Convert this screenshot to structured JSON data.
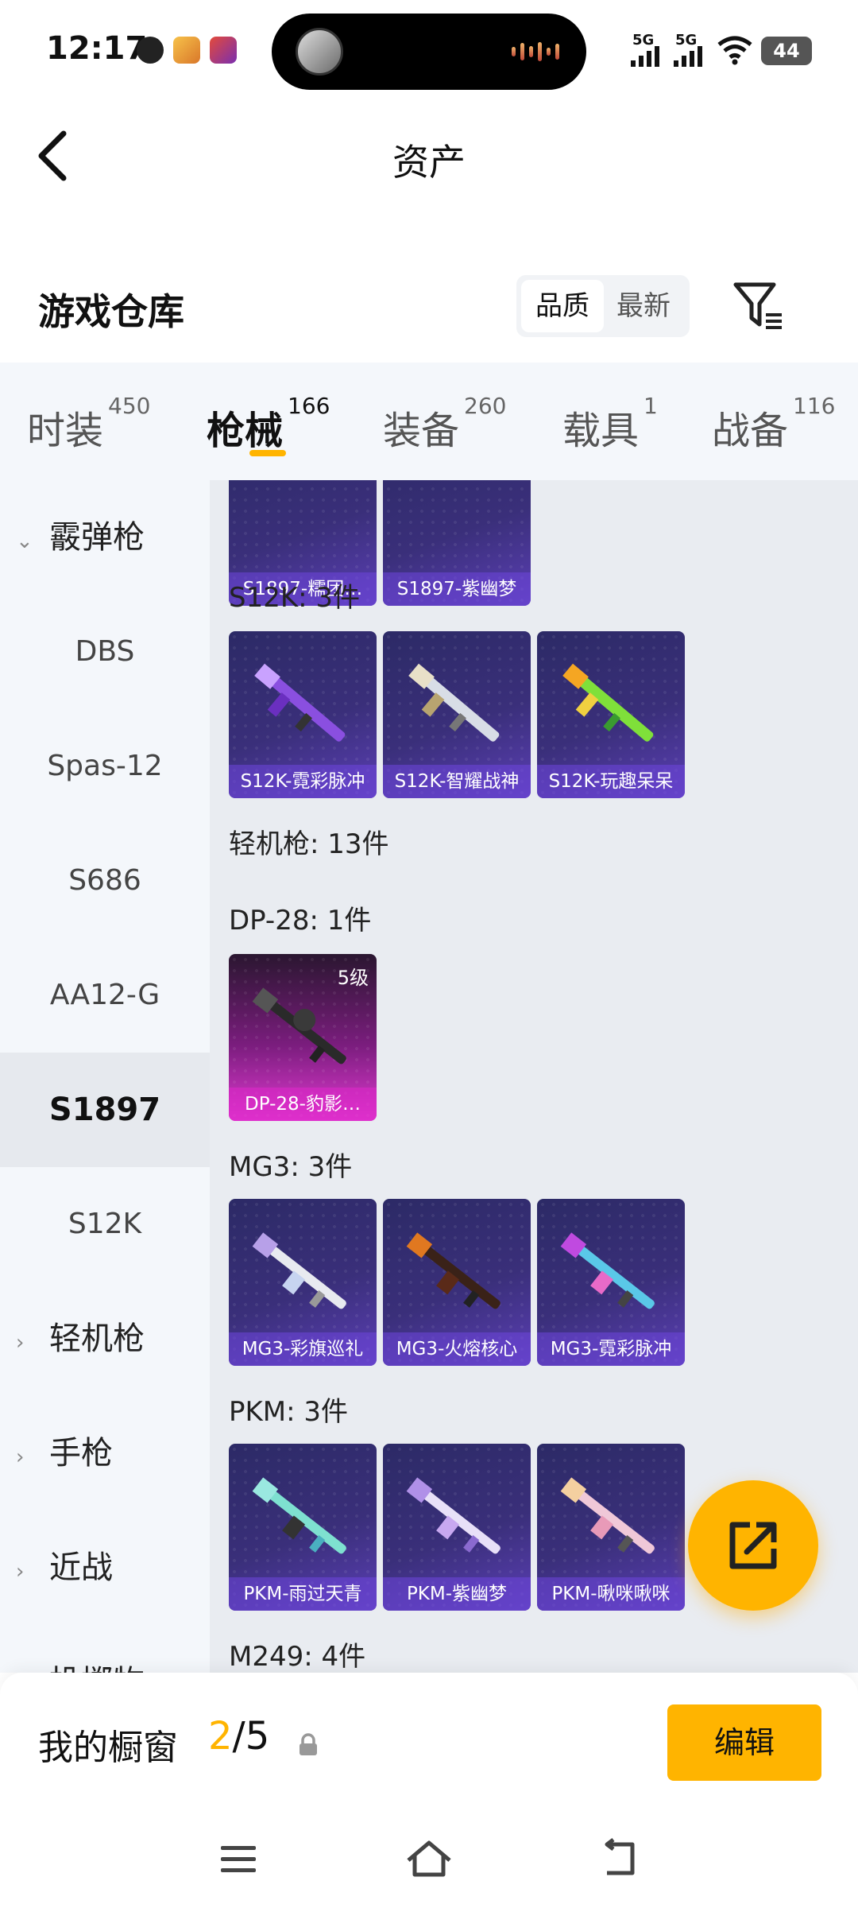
{
  "status_bar": {
    "time": "12:17",
    "signal_1": "5G",
    "signal_2": "5G",
    "battery": "44"
  },
  "header": {
    "title": "资产"
  },
  "warehouse": {
    "title": "游戏仓库",
    "sort_options": [
      "品质",
      "最新"
    ]
  },
  "tabs": [
    {
      "label": "时装",
      "count": "450"
    },
    {
      "label": "枪械",
      "count": "166"
    },
    {
      "label": "装备",
      "count": "260"
    },
    {
      "label": "载具",
      "count": "1"
    },
    {
      "label": "战备",
      "count": "116"
    }
  ],
  "sidebar": {
    "group_shotgun": "霰弹枪",
    "items": [
      "DBS",
      "Spas-12",
      "S686",
      "AA12-G",
      "S1897",
      "S12K"
    ],
    "group_lmg": "轻机枪",
    "group_pistol": "手枪",
    "group_melee": "近战",
    "group_next": "投掷物"
  },
  "content": {
    "s1897_cards": [
      "S1897-糯团…",
      "S1897-紫幽梦"
    ],
    "s12k_label": "S12K: 3件",
    "s12k_cards": [
      "S12K-霓彩脉冲",
      "S12K-智耀战神",
      "S12K-玩趣呆呆"
    ],
    "lmg_label": "轻机枪: 13件",
    "dp28_label": "DP-28: 1件",
    "dp28_card": {
      "name": "DP-28-豹影…",
      "level": "5级"
    },
    "mg3_label": "MG3: 3件",
    "mg3_cards": [
      "MG3-彩旗巡礼",
      "MG3-火熔核心",
      "MG3-霓彩脉冲"
    ],
    "pkm_label": "PKM: 3件",
    "pkm_cards": [
      "PKM-雨过天青",
      "PKM-紫幽梦",
      "PKM-啾咪啾咪"
    ],
    "m249_label": "M249: 4件"
  },
  "showcase": {
    "label": "我的橱窗",
    "current": "2",
    "total": "/5",
    "edit_label": "编辑"
  },
  "colors": {
    "accent": "#ffb400",
    "card_purple": "#3a2f7a",
    "card_pink": "#e23ad2"
  }
}
